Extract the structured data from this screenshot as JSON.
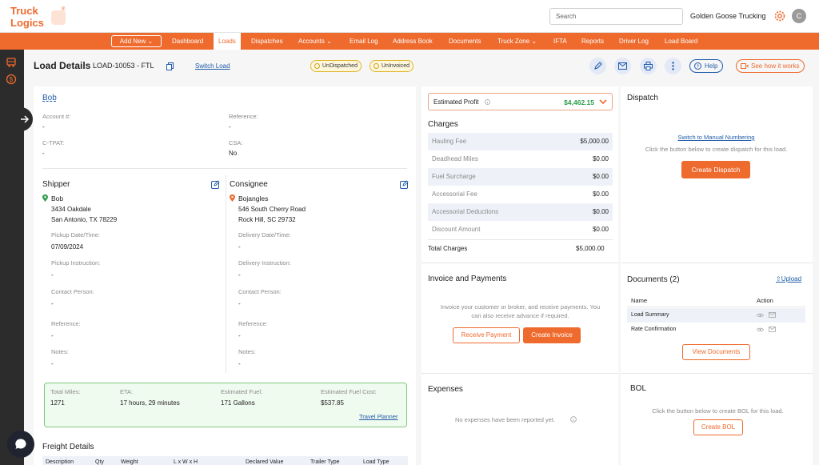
{
  "brand": {
    "logo_line1": "Truck",
    "logo_line2": "Logics",
    "accent": "#ee6a2d",
    "link": "#1f5ba8"
  },
  "topbar": {
    "search_placeholder": "Search",
    "company": "Golden Goose Trucking",
    "avatar_initial": "C"
  },
  "nav": {
    "add_new": "Add New",
    "items": [
      "Dashboard",
      "Loads",
      "Dispatches",
      "Accounts",
      "Email Log",
      "Address Book",
      "Documents",
      "Truck Zone",
      "IFTA",
      "Reports",
      "Driver Log",
      "Load Board"
    ],
    "active": "Loads"
  },
  "header": {
    "title": "Load Details",
    "load_id": "LOAD-10053 - FTL",
    "switch_load": "Switch Load",
    "badges": [
      "UnDispatched",
      "UnInvoiced"
    ],
    "help": "Help",
    "how_it_works": "See how it works"
  },
  "customer": {
    "name": "Bob",
    "account_label": "Account #:",
    "account": "-",
    "reference_label": "Reference:",
    "reference": "-",
    "ctpat_label": "C-TPAT:",
    "ctpat": "-",
    "csa_label": "CSA:",
    "csa": "No"
  },
  "shipper": {
    "heading": "Shipper",
    "name": "Bob",
    "address1": "3434 Oakdale",
    "address2": "San Antonio, TX 78229",
    "date_label": "Pickup Date/Time:",
    "date": "07/09/2024",
    "instr_label": "Pickup Instruction:",
    "instr": "-",
    "contact_label": "Contact Person:",
    "contact": "-",
    "ref_label": "Reference:",
    "ref": "-",
    "notes_label": "Notes:",
    "notes": "-"
  },
  "consignee": {
    "heading": "Consignee",
    "name": "Bojangles",
    "address1": "546 South Cherry Road",
    "address2": "Rock Hill, SC 29732",
    "date_label": "Delivery Date/Time:",
    "date": "-",
    "instr_label": "Delivery Instruction:",
    "instr": "-",
    "contact_label": "Contact Person:",
    "contact": "-",
    "ref_label": "Reference:",
    "ref": "-",
    "notes_label": "Notes:",
    "notes": "-"
  },
  "trip": {
    "miles_label": "Total Miles:",
    "miles": "1271",
    "eta_label": "ETA:",
    "eta": "17 hours, 29 minutes",
    "fuel_label": "Estimated Fuel:",
    "fuel": "171 Gallons",
    "cost_label": "Estimated Fuel Cost:",
    "cost": "$537.85",
    "planner": "Travel Planner"
  },
  "freight": {
    "heading": "Freight Details",
    "columns": [
      "Description",
      "Qty",
      "Weight",
      "L x W x H",
      "Declared Value",
      "Trailer Type",
      "Load Type"
    ]
  },
  "profit": {
    "label": "Estimated Profit",
    "value": "$4,462.15"
  },
  "charges": {
    "heading": "Charges",
    "rows": [
      {
        "name": "Hauling Fee",
        "value": "$5,000.00"
      },
      {
        "name": "Deadhead Miles",
        "value": "$0.00"
      },
      {
        "name": "Fuel Surcharge",
        "value": "$0.00"
      },
      {
        "name": "Accessorial Fee",
        "value": "$0.00"
      },
      {
        "name": "Accessorial Deductions",
        "value": "$0.00"
      },
      {
        "name": "Discount Amount",
        "value": "$0.00"
      }
    ],
    "total_label": "Total Charges",
    "total": "$5,000.00"
  },
  "invoice": {
    "heading": "Invoice and Payments",
    "text1": "Invoice your customer or broker, and receive payments. You",
    "text2": "can also receive advance if required.",
    "receive": "Receive Payment",
    "create": "Create Invoice"
  },
  "expenses": {
    "heading": "Expenses",
    "empty": "No expenses have been reported yet."
  },
  "dispatch": {
    "heading": "Dispatch",
    "switch": "Switch to Manual Numbering",
    "text": "Click the button below to create dispatch for this load.",
    "button": "Create Dispatch"
  },
  "documents": {
    "heading": "Documents (2)",
    "upload": "Upload",
    "col_name": "Name",
    "col_action": "Action",
    "rows": [
      "Load Summary",
      "Rate Confirmation"
    ],
    "view": "View Documents"
  },
  "bol": {
    "heading": "BOL",
    "text": "Click the button below to create BOL for this load.",
    "button": "Create BOL"
  }
}
